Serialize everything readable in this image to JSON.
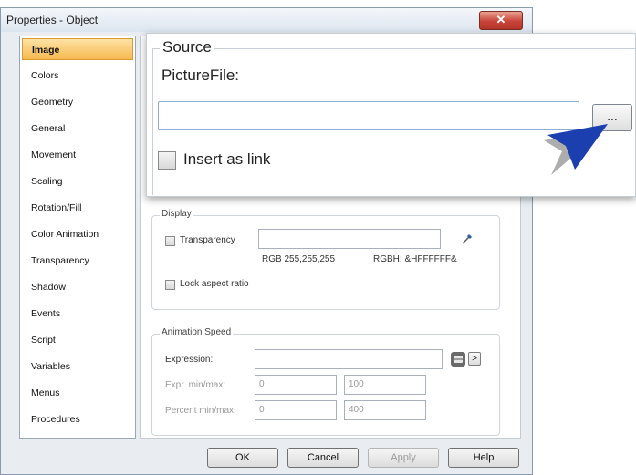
{
  "window": {
    "title": "Properties - Object",
    "close_glyph": "✕"
  },
  "nav": {
    "items": [
      {
        "label": "Image",
        "active": true
      },
      {
        "label": "Colors"
      },
      {
        "label": "Geometry"
      },
      {
        "label": "General"
      },
      {
        "label": "Movement"
      },
      {
        "label": "Scaling"
      },
      {
        "label": "Rotation/Fill"
      },
      {
        "label": "Color Animation"
      },
      {
        "label": "Transparency"
      },
      {
        "label": "Shadow"
      },
      {
        "label": "Events"
      },
      {
        "label": "Script"
      },
      {
        "label": "Variables"
      },
      {
        "label": "Menus"
      },
      {
        "label": "Procedures"
      }
    ]
  },
  "display": {
    "title": "Display",
    "transparency_label": "Transparency",
    "rgb_label": "RGB 255,255,255",
    "rgbh_label": "RGBH: &HFFFFFF&",
    "lock_label": "Lock aspect ratio"
  },
  "animation": {
    "title": "Animation Speed",
    "expression_label": "Expression:",
    "expr_minmax_label": "Expr. min/max:",
    "expr_min": "0",
    "expr_max": "100",
    "percent_minmax_label": "Percent min/max:",
    "percent_min": "0",
    "percent_max": "400",
    "more_glyph": ">"
  },
  "buttons": {
    "ok": "OK",
    "cancel": "Cancel",
    "apply": "Apply",
    "help": "Help"
  },
  "callout": {
    "group_title": "Source",
    "field_label": "PictureFile:",
    "picture_file_value": "",
    "browse_label": "...",
    "insert_link_label": "Insert as link"
  },
  "colors": {
    "accent": "#f7b84d",
    "pointer": "#1b3fae",
    "close": "#c9443a"
  }
}
